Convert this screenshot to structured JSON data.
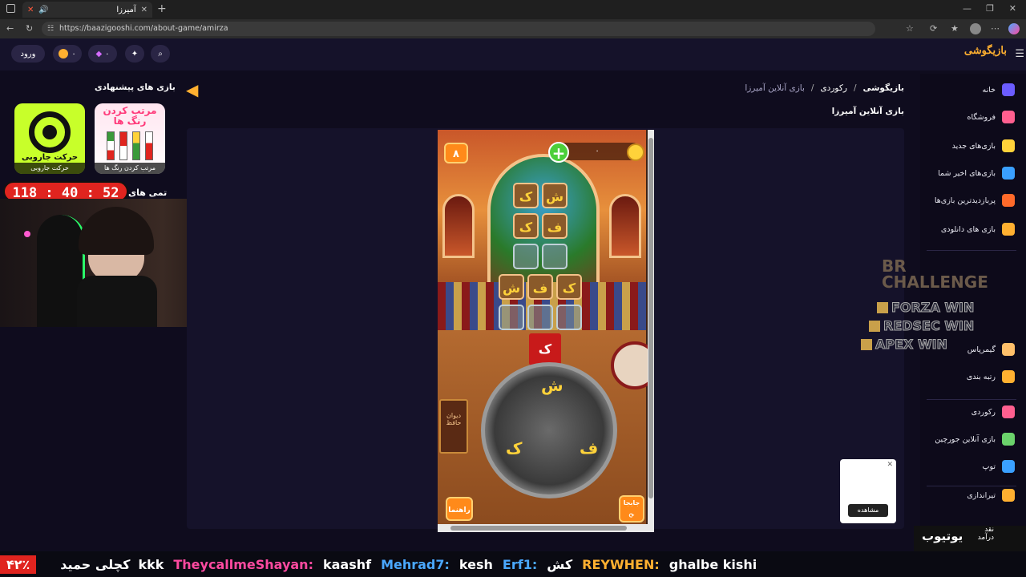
{
  "browser": {
    "tab_title": "آمیرزا",
    "url": "https://baazigooshi.com/about-game/amirza"
  },
  "header": {
    "login_label": "ورود",
    "coins": "۰",
    "gems": "۰",
    "logo": "بازیگوشی"
  },
  "sidebar": {
    "items": [
      {
        "label": "خانه",
        "icon": "home-icon",
        "color": "#6b5cff"
      },
      {
        "label": "فروشگاه",
        "icon": "shop-icon",
        "color": "#ff5f8f"
      },
      {
        "label": "بازی‌های جدید",
        "icon": "sparkle-icon",
        "color": "#ffd23a"
      },
      {
        "label": "بازی‌های اخیر شما",
        "icon": "clock-icon",
        "color": "#3aa0ff"
      },
      {
        "label": "پربازدیدترین بازی‌ها",
        "icon": "fire-icon",
        "color": "#ff6a2a"
      },
      {
        "label": "بازی های دانلودی",
        "icon": "download-icon",
        "color": "#ffb030"
      },
      {
        "label": "گیمرپاس",
        "icon": "gamer-icon",
        "color": "#ffc06a"
      },
      {
        "label": "رتبه بندی",
        "icon": "trophy-icon",
        "color": "#ffb030"
      },
      {
        "label": "رکوردی",
        "icon": "crown-icon",
        "color": "#ff5f8f"
      },
      {
        "label": "بازی آنلاین جورچین",
        "icon": "puzzle-icon",
        "color": "#6bd36b"
      },
      {
        "label": "توپ",
        "icon": "ball-icon",
        "color": "#3aa0ff"
      },
      {
        "label": "تیراندازی",
        "icon": "gun-icon",
        "color": "#ffb030"
      }
    ]
  },
  "breadcrumb": {
    "root": "بازیگوشی",
    "category": "رکوردی",
    "current": "بازی آنلاین آمیرزا"
  },
  "page_title": "بازی آنلاین آمیرزا",
  "suggested": {
    "title": "بازی های پیشنهادی",
    "items": [
      {
        "label": "مرتب کردن رنگ ها",
        "art_text": "مرتب کردن رنگ ها"
      },
      {
        "label": "حرکت جاروبی",
        "art_text": "حرکت جاروبی"
      }
    ],
    "timer": "118 : 40 : 52",
    "partial_label": "تمی های"
  },
  "game": {
    "level": "۸",
    "coins": "۰",
    "grid_rows": [
      [
        "ک",
        "ش"
      ],
      [
        "ک",
        "ف"
      ],
      [
        "",
        ""
      ],
      [
        "ش",
        "ف",
        "ک"
      ],
      [
        "",
        "",
        ""
      ]
    ],
    "current_letter": "ک",
    "wheel_letters": [
      "ش",
      "ک",
      "ف"
    ],
    "help_label": "راهنما",
    "shuffle_label": "جابجا",
    "book_text": "دیوان حافظ"
  },
  "overlay": {
    "challenge_title": "BR CHALLENGE",
    "challenge_items": [
      "FORZA WIN",
      "REDSEC WIN",
      "APEX WIN"
    ],
    "ad_button": "مشاهده",
    "corner_text_1": "نقد",
    "corner_text_2": "درآمد",
    "corner_text_3": "یوتیوب"
  },
  "ticker": {
    "percent": "۴۲٪",
    "name": "کچلی حمید",
    "messages": [
      {
        "user": "kkk",
        "text": "",
        "color": "#ffffff"
      },
      {
        "user": "TheycallmeShayan:",
        "text": "kaashf",
        "color": "#ff4aa0"
      },
      {
        "user": "Mehrad7:",
        "text": "kesh",
        "color": "#4aa8ff"
      },
      {
        "user": "Erf1:",
        "text": "کش",
        "color": "#4aa8ff"
      },
      {
        "user": "REYWHEN:",
        "text": "ghalbe kishi",
        "color": "#ffb030"
      }
    ]
  },
  "colors": {
    "bg": "#0f0c1e",
    "panel": "#15122a",
    "accent": "#ffb030",
    "timer_red": "#e0241f"
  }
}
